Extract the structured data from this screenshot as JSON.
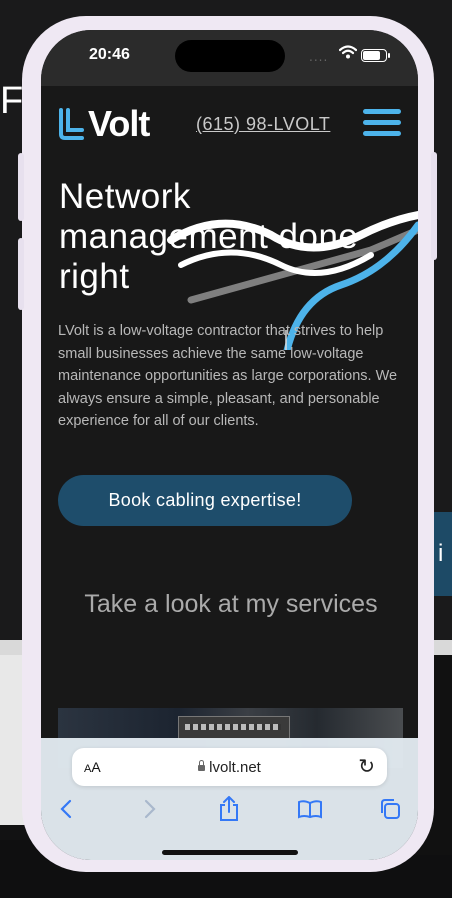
{
  "background": {
    "partial_button_text": "i",
    "partial_glyph": "F"
  },
  "status_bar": {
    "time": "20:46",
    "signal": "....",
    "icons": [
      "wifi-icon",
      "battery-icon"
    ]
  },
  "site": {
    "logo_text": "Volt",
    "phone": "(615) 98-LVOLT",
    "hero_title": "Network management done right",
    "hero_body": "LVolt is a low-voltage contractor that strives to help small businesses achieve the same low-voltage maintenance opportunities as large corporations. We always ensure a simple, pleasant, and personable experience for all of our clients.",
    "cta_label": "Book cabling expertise!",
    "services_title": "Take a look at my services"
  },
  "browser": {
    "aa_label": "AA",
    "url": "lvolt.net",
    "toolbar_icons": [
      "back-icon",
      "forward-icon",
      "share-icon",
      "bookmarks-icon",
      "tabs-icon"
    ]
  },
  "colors": {
    "accent": "#4db3ea",
    "cta": "#1e4d6b",
    "page_bg": "#181818"
  }
}
